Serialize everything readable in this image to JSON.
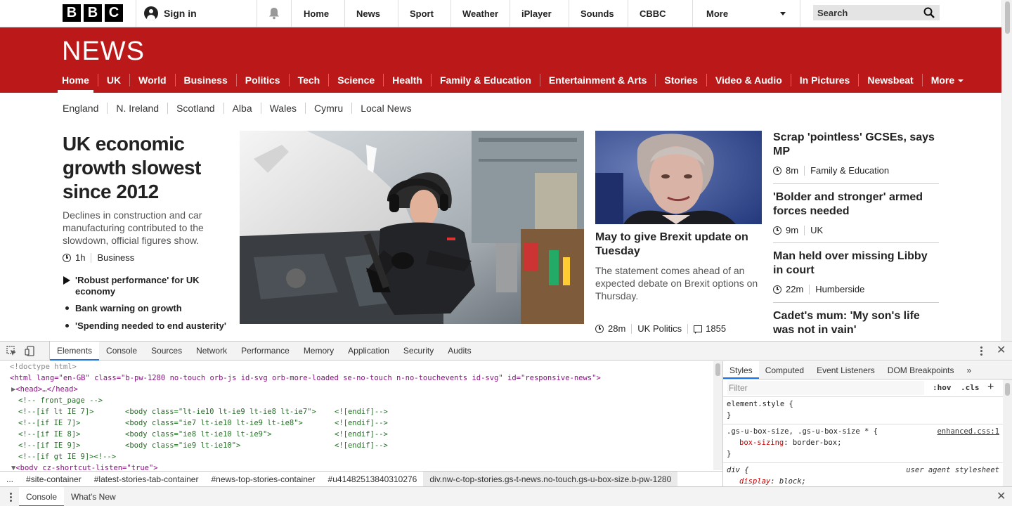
{
  "orb": {
    "logo_letters": [
      "B",
      "B",
      "C"
    ],
    "signin_label": "Sign in",
    "nav": [
      "Home",
      "News",
      "Sport",
      "Weather",
      "iPlayer",
      "Sounds",
      "CBBC"
    ],
    "more_label": "More",
    "search_label": "Search"
  },
  "masthead": {
    "logo": "NEWS",
    "nav": [
      "Home",
      "UK",
      "World",
      "Business",
      "Politics",
      "Tech",
      "Science",
      "Health",
      "Family & Education",
      "Entertainment & Arts",
      "Stories",
      "Video & Audio",
      "In Pictures",
      "Newsbeat"
    ],
    "more_label": "More",
    "active": "Home"
  },
  "secondary_nav": [
    "England",
    "N. Ireland",
    "Scotland",
    "Alba",
    "Wales",
    "Cymru",
    "Local News"
  ],
  "lead": {
    "title": "UK economic growth slowest since 2012",
    "summary": "Declines in construction and car manufacturing contributed to the slowdown, official figures show.",
    "time": "1h",
    "section": "Business",
    "related": [
      "'Robust performance' for UK economy",
      "Bank warning on growth",
      "'Spending needed to end austerity'"
    ]
  },
  "story2": {
    "title": "May to give Brexit update on Tuesday",
    "summary": "The statement comes ahead of an expected debate on Brexit options on Thursday.",
    "time": "28m",
    "section": "UK Politics",
    "comments": "1855"
  },
  "right_column": [
    {
      "title": "Scrap 'pointless' GCSEs, says MP",
      "time": "8m",
      "section": "Family & Education"
    },
    {
      "title": "'Bolder and stronger' armed forces needed",
      "time": "9m",
      "section": "UK"
    },
    {
      "title": "Man held over missing Libby in court",
      "time": "22m",
      "section": "Humberside"
    },
    {
      "title": "Cadet's mum: 'My son's life was not in vain'"
    }
  ],
  "devtools": {
    "tabs": [
      "Elements",
      "Console",
      "Sources",
      "Network",
      "Performance",
      "Memory",
      "Application",
      "Security",
      "Audits"
    ],
    "active_tab": "Elements",
    "dom": {
      "doctype": "<!doctype html>",
      "html_open": "<html lang=\"en-GB\" class=\"b-pw-1280 no-touch orb-js id-svg orb-more-loaded se-no-touch n-no-touchevents id-svg\" id=\"responsive-news\">",
      "head": "<head>…</head>",
      "front_page": "<!-- front_page -->",
      "ie7lt_cond": "<!--[if lt IE 7]>",
      "ie7lt_body": "<body class=\"lt-ie10 lt-ie9 lt-ie8 lt-ie7\">",
      "ie7_cond": "<!--[if IE 7]>",
      "ie7_body": "<body class=\"ie7 lt-ie10 lt-ie9 lt-ie8\">",
      "ie8_cond": "<!--[if IE 8]>",
      "ie8_body": "<body class=\"ie8 lt-ie10 lt-ie9\">",
      "ie9_cond": "<!--[if IE 9]>",
      "ie9_body": "<body class=\"ie9 lt-ie10\">",
      "endif": "<![endif]-->",
      "gtie9": "<!--[if gt IE 9]><!-->",
      "body_open": "<body cz-shortcut-listen=\"true\">"
    },
    "breadcrumbs": [
      "...",
      "#site-container",
      "#latest-stories-tab-container",
      "#news-top-stories-container",
      "#u41482513840310276",
      "div.nw-c-top-stories.gs-t-news.no-touch.gs-u-box-size.b-pw-1280"
    ],
    "styles_tabs": [
      "Styles",
      "Computed",
      "Event Listeners",
      "DOM Breakpoints"
    ],
    "styles_more": "»",
    "filter_placeholder": "Filter",
    "hov": ":hov",
    "cls": ".cls",
    "rules": {
      "element_style": "element.style {",
      "close": "}",
      "box_selector": ".gs-u-box-size, .gs-u-box-size * {",
      "box_source": "enhanced.css:1",
      "box_prop": "box-sizing",
      "box_val": "border-box;",
      "div_selector": "div {",
      "div_source": "user agent stylesheet",
      "div_prop": "display",
      "div_val": "block;"
    },
    "drawer_tabs": [
      "Console",
      "What's New"
    ]
  }
}
